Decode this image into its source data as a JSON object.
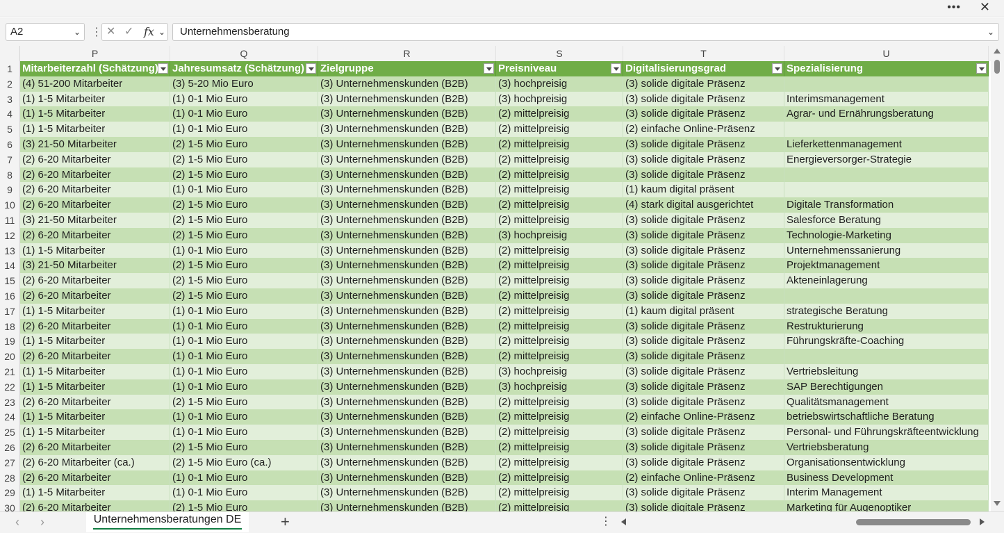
{
  "window": {
    "more_label": "•••",
    "close_label": "✕"
  },
  "formula_bar": {
    "name_box": "A2",
    "separator": "⋮",
    "cancel_label": "✕",
    "enter_label": "✓",
    "fx_label": "fx",
    "content": "Unternehmensberatung"
  },
  "columns": [
    "P",
    "Q",
    "R",
    "S",
    "T",
    "U"
  ],
  "headers": [
    "Mitarbeiterzahl (Schätzung)",
    "Jahresumsatz (Schätzung)",
    "Zielgruppe",
    "Preisniveau",
    "Digitalisierungsgrad",
    "Spezialisierung"
  ],
  "rows": [
    {
      "n": "2",
      "c": [
        "(4) 51-200 Mitarbeiter",
        "(3) 5-20 Mio Euro",
        "(3) Unternehmenskunden (B2B)",
        "(3) hochpreisig",
        "(3) solide digitale Präsenz",
        ""
      ]
    },
    {
      "n": "3",
      "c": [
        "(1) 1-5 Mitarbeiter",
        "(1) 0-1 Mio Euro",
        "(3) Unternehmenskunden (B2B)",
        "(3) hochpreisig",
        "(3) solide digitale Präsenz",
        "Interimsmanagement"
      ]
    },
    {
      "n": "4",
      "c": [
        "(1) 1-5 Mitarbeiter",
        "(1) 0-1 Mio Euro",
        "(3) Unternehmenskunden (B2B)",
        "(2) mittelpreisig",
        "(3) solide digitale Präsenz",
        "Agrar- und Ernährungsberatung"
      ]
    },
    {
      "n": "5",
      "c": [
        "(1) 1-5 Mitarbeiter",
        "(1) 0-1 Mio Euro",
        "(3) Unternehmenskunden (B2B)",
        "(2) mittelpreisig",
        "(2) einfache Online-Präsenz",
        ""
      ]
    },
    {
      "n": "6",
      "c": [
        "(3) 21-50 Mitarbeiter",
        "(2) 1-5 Mio Euro",
        "(3) Unternehmenskunden (B2B)",
        "(2) mittelpreisig",
        "(3) solide digitale Präsenz",
        "Lieferkettenmanagement"
      ]
    },
    {
      "n": "7",
      "c": [
        "(2) 6-20 Mitarbeiter",
        "(2) 1-5 Mio Euro",
        "(3) Unternehmenskunden (B2B)",
        "(2) mittelpreisig",
        "(3) solide digitale Präsenz",
        "Energieversorger-Strategie"
      ]
    },
    {
      "n": "8",
      "c": [
        "(2) 6-20 Mitarbeiter",
        "(2) 1-5 Mio Euro",
        "(3) Unternehmenskunden (B2B)",
        "(2) mittelpreisig",
        "(3) solide digitale Präsenz",
        ""
      ]
    },
    {
      "n": "9",
      "c": [
        "(2) 6-20 Mitarbeiter",
        "(1) 0-1 Mio Euro",
        "(3) Unternehmenskunden (B2B)",
        "(2) mittelpreisig",
        "(1) kaum digital präsent",
        ""
      ]
    },
    {
      "n": "10",
      "c": [
        "(2) 6-20 Mitarbeiter",
        "(2) 1-5 Mio Euro",
        "(3) Unternehmenskunden (B2B)",
        "(2) mittelpreisig",
        "(4) stark digital ausgerichtet",
        "Digitale Transformation"
      ]
    },
    {
      "n": "11",
      "c": [
        "(3) 21-50 Mitarbeiter",
        "(2) 1-5 Mio Euro",
        "(3) Unternehmenskunden (B2B)",
        "(2) mittelpreisig",
        "(3) solide digitale Präsenz",
        "Salesforce Beratung"
      ]
    },
    {
      "n": "12",
      "c": [
        "(2) 6-20 Mitarbeiter",
        "(2) 1-5 Mio Euro",
        "(3) Unternehmenskunden (B2B)",
        "(3) hochpreisig",
        "(3) solide digitale Präsenz",
        "Technologie-Marketing"
      ]
    },
    {
      "n": "13",
      "c": [
        "(1) 1-5 Mitarbeiter",
        "(1) 0-1 Mio Euro",
        "(3) Unternehmenskunden (B2B)",
        "(2) mittelpreisig",
        "(3) solide digitale Präsenz",
        "Unternehmenssanierung"
      ]
    },
    {
      "n": "14",
      "c": [
        "(3) 21-50 Mitarbeiter",
        "(2) 1-5 Mio Euro",
        "(3) Unternehmenskunden (B2B)",
        "(2) mittelpreisig",
        "(3) solide digitale Präsenz",
        "Projektmanagement"
      ]
    },
    {
      "n": "15",
      "c": [
        "(2) 6-20 Mitarbeiter",
        "(2) 1-5 Mio Euro",
        "(3) Unternehmenskunden (B2B)",
        "(2) mittelpreisig",
        "(3) solide digitale Präsenz",
        "Akteneinlagerung"
      ]
    },
    {
      "n": "16",
      "c": [
        "(2) 6-20 Mitarbeiter",
        "(2) 1-5 Mio Euro",
        "(3) Unternehmenskunden (B2B)",
        "(2) mittelpreisig",
        "(3) solide digitale Präsenz",
        ""
      ]
    },
    {
      "n": "17",
      "c": [
        "(1) 1-5 Mitarbeiter",
        "(1) 0-1 Mio Euro",
        "(3) Unternehmenskunden (B2B)",
        "(2) mittelpreisig",
        "(1) kaum digital präsent",
        "strategische Beratung"
      ]
    },
    {
      "n": "18",
      "c": [
        "(2) 6-20 Mitarbeiter",
        "(1) 0-1 Mio Euro",
        "(3) Unternehmenskunden (B2B)",
        "(2) mittelpreisig",
        "(3) solide digitale Präsenz",
        "Restrukturierung"
      ]
    },
    {
      "n": "19",
      "c": [
        "(1) 1-5 Mitarbeiter",
        "(1) 0-1 Mio Euro",
        "(3) Unternehmenskunden (B2B)",
        "(2) mittelpreisig",
        "(3) solide digitale Präsenz",
        "Führungskräfte-Coaching"
      ]
    },
    {
      "n": "20",
      "c": [
        "(2) 6-20 Mitarbeiter",
        "(1) 0-1 Mio Euro",
        "(3) Unternehmenskunden (B2B)",
        "(2) mittelpreisig",
        "(3) solide digitale Präsenz",
        ""
      ]
    },
    {
      "n": "21",
      "c": [
        "(1) 1-5 Mitarbeiter",
        "(1) 0-1 Mio Euro",
        "(3) Unternehmenskunden (B2B)",
        "(3) hochpreisig",
        "(3) solide digitale Präsenz",
        "Vertriebsleitung"
      ]
    },
    {
      "n": "22",
      "c": [
        "(1) 1-5 Mitarbeiter",
        "(1) 0-1 Mio Euro",
        "(3) Unternehmenskunden (B2B)",
        "(3) hochpreisig",
        "(3) solide digitale Präsenz",
        "SAP Berechtigungen"
      ]
    },
    {
      "n": "23",
      "c": [
        "(2) 6-20 Mitarbeiter",
        "(2) 1-5 Mio Euro",
        "(3) Unternehmenskunden (B2B)",
        "(2) mittelpreisig",
        "(3) solide digitale Präsenz",
        "Qualitätsmanagement"
      ]
    },
    {
      "n": "24",
      "c": [
        "(1) 1-5 Mitarbeiter",
        "(1) 0-1 Mio Euro",
        "(3) Unternehmenskunden (B2B)",
        "(2) mittelpreisig",
        "(2) einfache Online-Präsenz",
        "betriebswirtschaftliche Beratung"
      ]
    },
    {
      "n": "25",
      "c": [
        "(1) 1-5 Mitarbeiter",
        "(1) 0-1 Mio Euro",
        "(3) Unternehmenskunden (B2B)",
        "(2) mittelpreisig",
        "(3) solide digitale Präsenz",
        "Personal- und Führungskräfteentwicklung"
      ]
    },
    {
      "n": "26",
      "c": [
        "(2) 6-20 Mitarbeiter",
        "(2) 1-5 Mio Euro",
        "(3) Unternehmenskunden (B2B)",
        "(2) mittelpreisig",
        "(3) solide digitale Präsenz",
        "Vertriebsberatung"
      ]
    },
    {
      "n": "27",
      "c": [
        "(2) 6-20 Mitarbeiter (ca.)",
        "(2) 1-5 Mio Euro (ca.)",
        "(3) Unternehmenskunden (B2B)",
        "(2) mittelpreisig",
        "(3) solide digitale Präsenz",
        "Organisationsentwicklung"
      ]
    },
    {
      "n": "28",
      "c": [
        "(2) 6-20 Mitarbeiter",
        "(1) 0-1 Mio Euro",
        "(3) Unternehmenskunden (B2B)",
        "(2) mittelpreisig",
        "(2) einfache Online-Präsenz",
        "Business Development"
      ]
    },
    {
      "n": "29",
      "c": [
        "(1) 1-5 Mitarbeiter",
        "(1) 0-1 Mio Euro",
        "(3) Unternehmenskunden (B2B)",
        "(2) mittelpreisig",
        "(3) solide digitale Präsenz",
        "Interim Management"
      ]
    },
    {
      "n": "30",
      "c": [
        "(2) 6-20 Mitarbeiter",
        "(2) 1-5 Mio Euro",
        "(3) Unternehmenskunden (B2B)",
        "(2) mittelpreisig",
        "(3) solide digitale Präsenz",
        "Marketing für Augenoptiker"
      ]
    }
  ],
  "sheet_tabs": {
    "active": "Unternehmensberatungen DE",
    "add_label": "+",
    "more_label": "⋮"
  },
  "colors": {
    "header_green": "#70ad47",
    "band_dark": "#c6e0b4",
    "band_light": "#e2efda",
    "accent": "#107c41"
  }
}
